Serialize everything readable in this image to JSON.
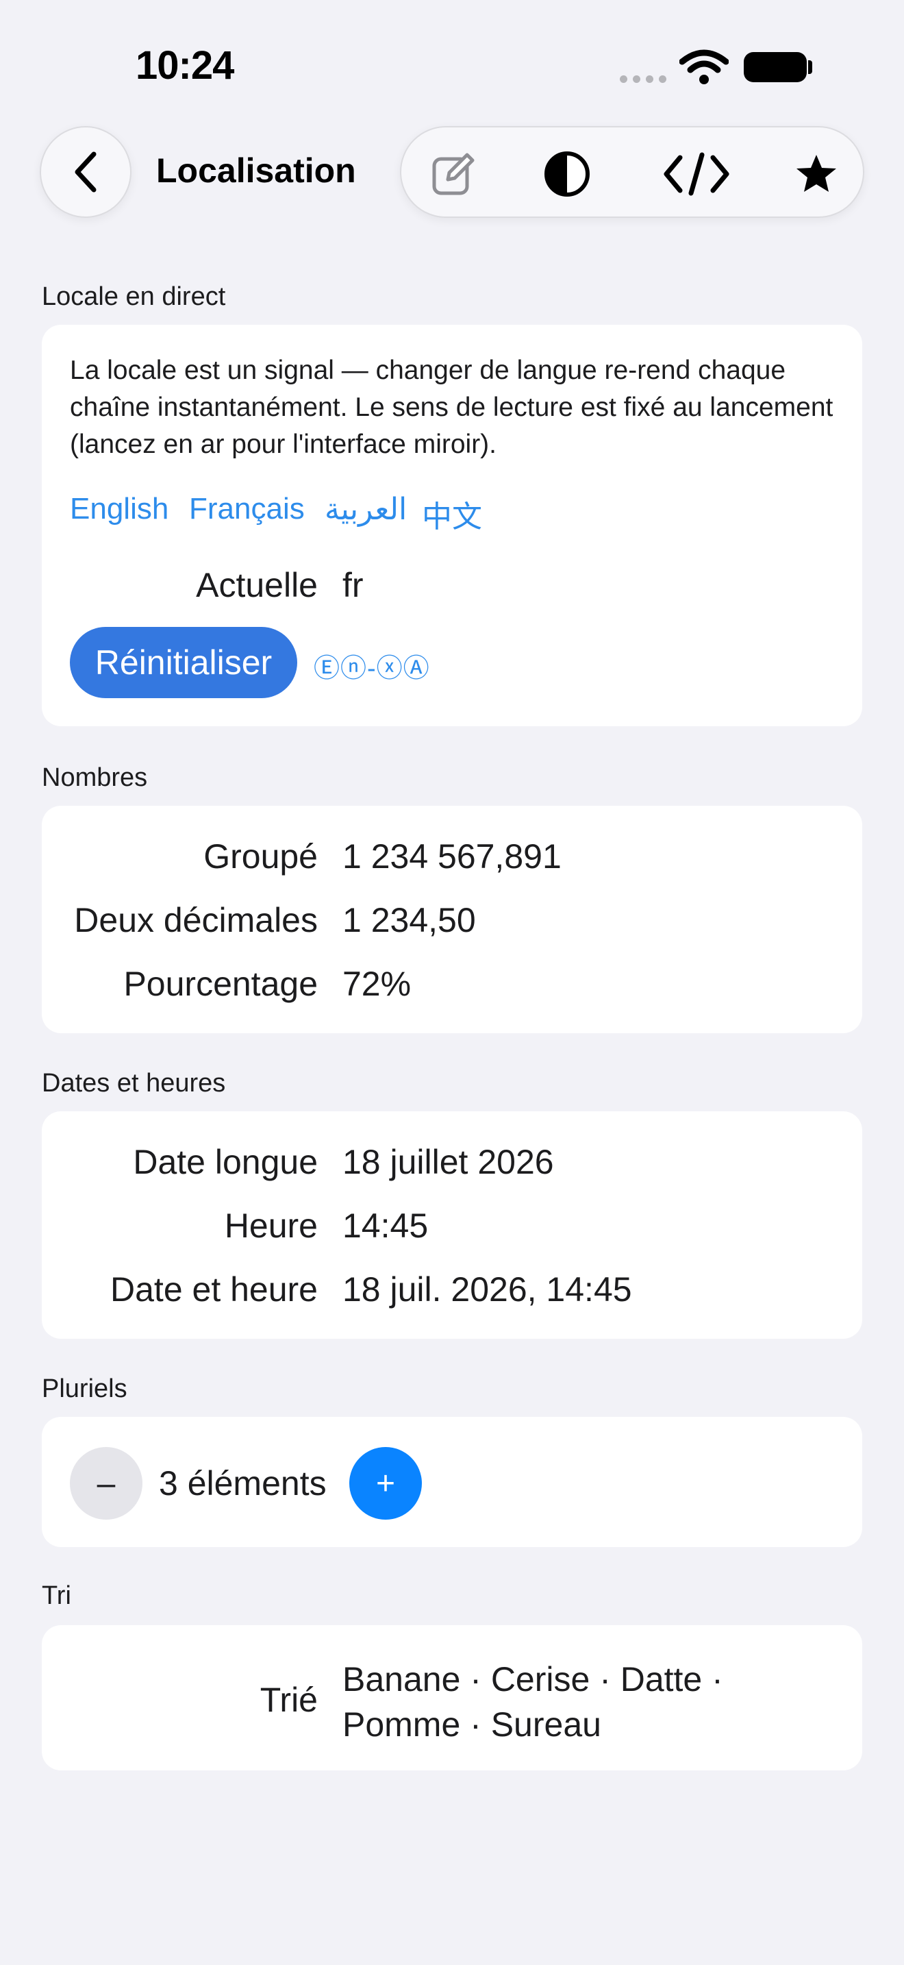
{
  "status_bar": {
    "time": "10:24"
  },
  "nav": {
    "title": "Localisation",
    "toolbar_icons": [
      "compose-icon",
      "contrast-icon",
      "code-icon",
      "star-icon"
    ]
  },
  "sections": {
    "live": {
      "label": "Locale en direct",
      "description": "La locale est un signal — changer de langue re-rend chaque chaîne instantanément. Le sens de lecture est fixé au lancement (lancez en ar pour l'interface miroir).",
      "languages": [
        "English",
        "Français",
        "العربية",
        "中文"
      ],
      "current_label": "Actuelle",
      "current_value": "fr",
      "reset_label": "Réinitialiser",
      "pseudo_label": "Ⓔⓝ-ⓧⒶ"
    },
    "numbers": {
      "label": "Nombres",
      "rows": [
        {
          "label": "Groupé",
          "value": "1 234 567,891"
        },
        {
          "label": "Deux décimales",
          "value": "1 234,50"
        },
        {
          "label": "Pourcentage",
          "value": "72%"
        }
      ]
    },
    "dates": {
      "label": "Dates et heures",
      "rows": [
        {
          "label": "Date longue",
          "value": "18 juillet 2026"
        },
        {
          "label": "Heure",
          "value": "14:45"
        },
        {
          "label": "Date et heure",
          "value": "18 juil. 2026, 14:45"
        }
      ]
    },
    "plurals": {
      "label": "Pluriels",
      "minus": "–",
      "count_text": "3 éléments",
      "plus": "+"
    },
    "sort": {
      "label": "Tri",
      "row_label": "Trié",
      "value_line1": "Banane · Cerise · Datte ·",
      "value_line2": "Pomme · Sureau"
    }
  },
  "colors": {
    "accent": "#2D8CEB",
    "button": "#3478E0",
    "plus": "#0A84FF",
    "background": "#F2F2F7"
  }
}
